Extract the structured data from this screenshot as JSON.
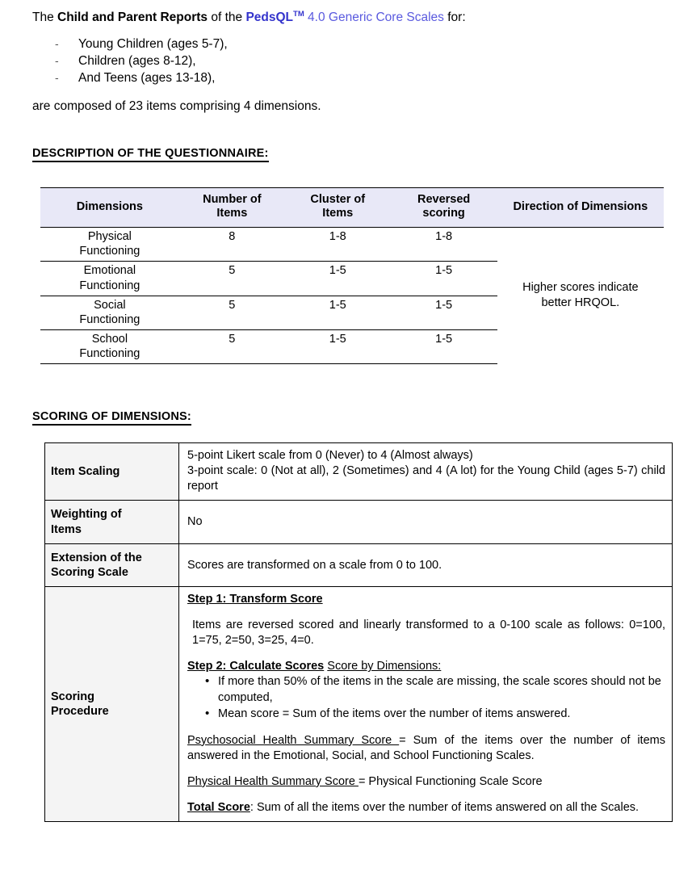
{
  "intro": {
    "prefix": "The ",
    "bold_part": "Child and Parent Reports",
    "middle": " of the ",
    "brand": "PedsQL",
    "brand_sup": "TM",
    "brand_rest": " 4.0 Generic Core Scales",
    "suffix": " for:"
  },
  "age_groups": [
    {
      "dash": "-",
      "text": "Young Children (ages 5-7),"
    },
    {
      "dash": "-",
      "text": "Children (ages 8-12),"
    },
    {
      "dash": "-",
      "text": "And Teens (ages 13-18),"
    }
  ],
  "composed_line": "are composed of 23 items comprising 4 dimensions.",
  "headings": {
    "description": "DESCRIPTION OF THE QUESTIONNAIRE:",
    "scoring": "SCORING OF DIMENSIONS:"
  },
  "dimensions_table": {
    "columns": [
      {
        "line1": "Dimensions",
        "line2": ""
      },
      {
        "line1": "Number of",
        "line2": "Items"
      },
      {
        "line1": "Cluster of",
        "line2": "Items"
      },
      {
        "line1": "Reversed",
        "line2": "scoring"
      },
      {
        "line1": "Direction of Dimensions",
        "line2": ""
      }
    ],
    "rows": [
      {
        "dim_l1": "Physical",
        "dim_l2": "Functioning",
        "number_of_items": "8",
        "cluster_of_items": "1-8",
        "reversed_scoring": "1-8"
      },
      {
        "dim_l1": "Emotional",
        "dim_l2": "Functioning",
        "number_of_items": "5",
        "cluster_of_items": "1-5",
        "reversed_scoring": "1-5"
      },
      {
        "dim_l1": "Social",
        "dim_l2": "Functioning",
        "number_of_items": "5",
        "cluster_of_items": "1-5",
        "reversed_scoring": "1-5"
      },
      {
        "dim_l1": "School",
        "dim_l2": "Functioning",
        "number_of_items": "5",
        "cluster_of_items": "1-5",
        "reversed_scoring": "1-5"
      }
    ],
    "direction_l1": "Higher scores indicate",
    "direction_l2": "better HRQOL."
  },
  "scoring_table": {
    "item_scaling": {
      "label": "Item Scaling",
      "line1": "5-point Likert scale from 0 (Never) to 4 (Almost always)",
      "line2": "3-point scale: 0 (Not at all), 2 (Sometimes) and 4 (A lot) for the Young Child (ages 5-7) child report"
    },
    "weighting": {
      "label_l1": "Weighting of",
      "label_l2": "Items",
      "value": "No"
    },
    "extension": {
      "label_l1": "Extension of the",
      "label_l2": "Scoring Scale",
      "value": "Scores are transformed on a scale from 0 to 100."
    },
    "procedure": {
      "label_l1": "Scoring",
      "label_l2": "Procedure",
      "step1_title": "Step 1: Transform Score",
      "step1_body": "Items are reversed scored and linearly transformed to a 0-100 scale as follows: 0=100, 1=75, 2=50, 3=25, 4=0.",
      "step2_title": "Step 2: Calculate Scores",
      "score_by_dimensions": "Score by Dimensions:",
      "bullets": [
        "If more than 50% of the items in the scale are missing, the scale scores should not be computed,",
        "Mean score = Sum of the items over the number of items answered."
      ],
      "psychosocial_label": "Psychosocial Health Summary Score ",
      "psychosocial_body": "= Sum of the items over the number of items answered in the Emotional, Social, and School Functioning Scales.",
      "physical_label": "Physical Health Summary Score ",
      "physical_body": "= Physical Functioning Scale Score",
      "total_label": "Total Score",
      "total_body": ": Sum of all the items over the number of items answered on all the Scales."
    }
  },
  "colors": {
    "brand": "#3333CC",
    "brand_secondary": "#5A5ADF",
    "table_header_bg": "#E8E8F7",
    "label_cell_bg": "#F4F4F4",
    "border": "#000000"
  }
}
